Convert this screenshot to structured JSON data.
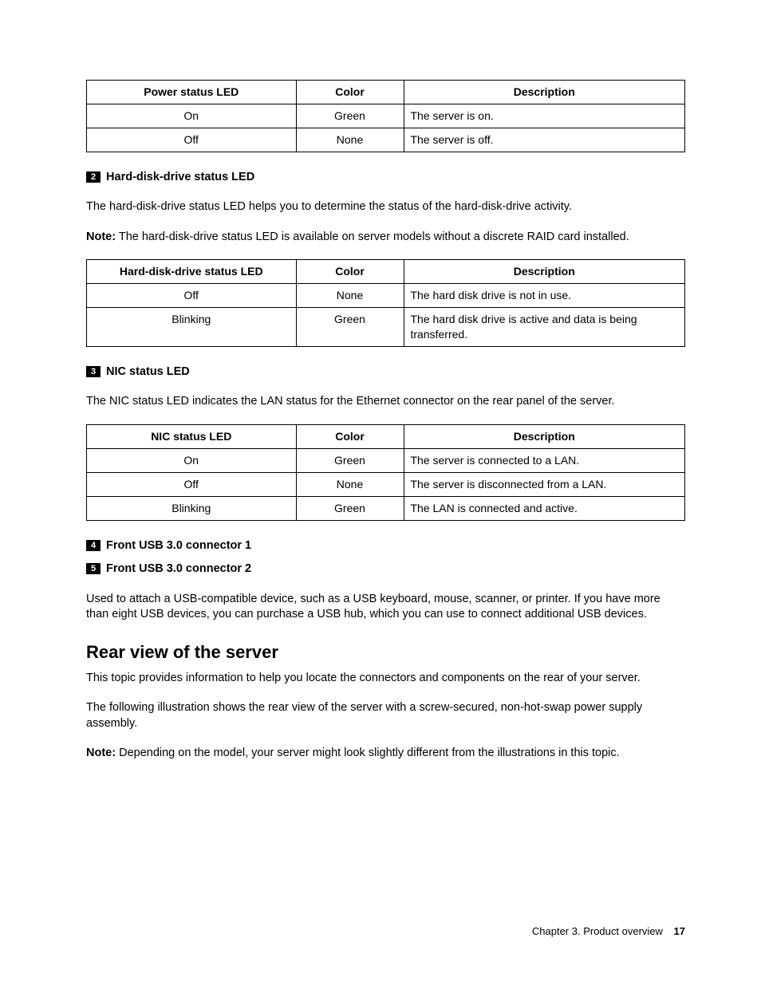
{
  "table_power": {
    "headers": [
      "Power status LED",
      "Color",
      "Description"
    ],
    "rows": [
      [
        "On",
        "Green",
        "The server is on."
      ],
      [
        "Off",
        "None",
        "The server is off."
      ]
    ]
  },
  "callout2": {
    "num": "2",
    "title": "Hard-disk-drive status LED"
  },
  "hdd_desc": "The hard-disk-drive status LED helps you to determine the status of the hard-disk-drive activity.",
  "note_label": "Note:",
  "hdd_note": "The hard-disk-drive status LED is available on server models without a discrete RAID card installed.",
  "table_hdd": {
    "headers": [
      "Hard-disk-drive status LED",
      "Color",
      "Description"
    ],
    "rows": [
      [
        "Off",
        "None",
        "The hard disk drive is not in use."
      ],
      [
        "Blinking",
        "Green",
        "The hard disk drive is active and data is being transferred."
      ]
    ]
  },
  "callout3": {
    "num": "3",
    "title": "NIC status LED"
  },
  "nic_desc": "The NIC status LED indicates the LAN status for the Ethernet connector on the rear panel of the server.",
  "table_nic": {
    "headers": [
      "NIC status LED",
      "Color",
      "Description"
    ],
    "rows": [
      [
        "On",
        "Green",
        "The server is connected to a LAN."
      ],
      [
        "Off",
        "None",
        "The server is disconnected from a LAN."
      ],
      [
        "Blinking",
        "Green",
        "The LAN is connected and active."
      ]
    ]
  },
  "callout4": {
    "num": "4",
    "title": "Front USB 3.0 connector 1"
  },
  "callout5": {
    "num": "5",
    "title": "Front USB 3.0 connector 2"
  },
  "usb_desc": "Used to attach a USB-compatible device, such as a USB keyboard, mouse, scanner, or printer. If you have more than eight USB devices, you can purchase a USB hub, which you can use to connect additional USB devices.",
  "rear_heading": "Rear view of the server",
  "rear_p1": "This topic provides information to help you locate the connectors and components on the rear of your server.",
  "rear_p2": "The following illustration shows the rear view of the server with a screw-secured, non-hot-swap power supply assembly.",
  "rear_note": "Depending on the model, your server might look slightly different from the illustrations in this topic.",
  "footer": {
    "chapter": "Chapter 3. Product overview",
    "page": "17"
  }
}
